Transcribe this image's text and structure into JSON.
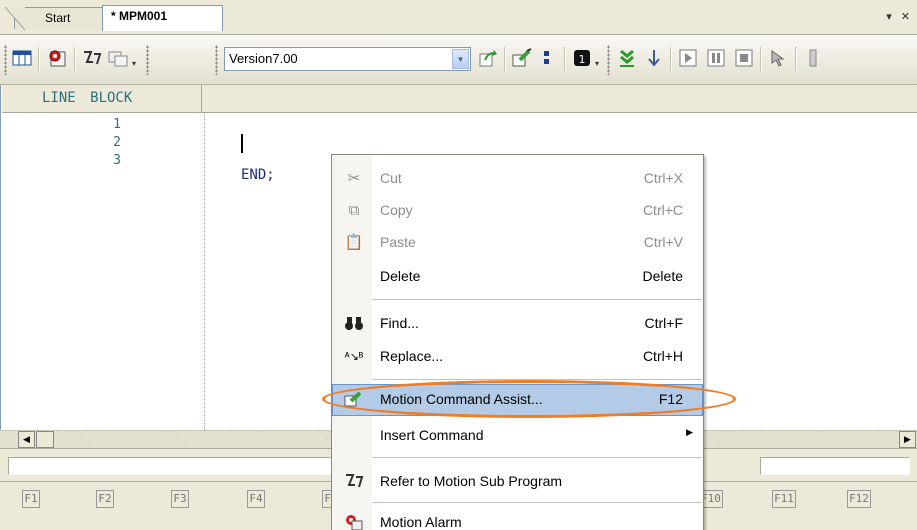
{
  "tabs": {
    "start_label": "Start",
    "active_label": "* MPM001",
    "controls": "▾ ✕"
  },
  "toolbar": {
    "version_value": "Version7.00",
    "icons": [
      "list-window-icon",
      "motion-search-icon",
      "motion-sub-icon",
      "transfer-icon",
      "motion-command-assist-icon",
      "semicolon-icon",
      "step-icon",
      "step-into-icon",
      "step-down-icon",
      "run-icon",
      "pause-icon",
      "stop-icon",
      "pointer-icon"
    ]
  },
  "editor": {
    "header": "LINE BLOCK",
    "line_numbers": [
      "1",
      "2",
      "3"
    ],
    "code_lines": [
      "",
      "",
      "END;"
    ]
  },
  "function_keys": [
    "F1",
    "F2",
    "F3",
    "F4",
    "F5",
    "F10",
    "F11",
    "F12"
  ],
  "context_menu": {
    "items": [
      {
        "label": "Cut",
        "shortcut": "Ctrl+X",
        "icon": "scissors-icon",
        "disabled": true
      },
      {
        "label": "Copy",
        "shortcut": "Ctrl+C",
        "icon": "copy-icon",
        "disabled": true
      },
      {
        "label": "Paste",
        "shortcut": "Ctrl+V",
        "icon": "paste-icon",
        "disabled": true
      },
      {
        "label": "Delete",
        "shortcut": "Delete",
        "icon": "",
        "disabled": false
      },
      {
        "label": "Find...",
        "shortcut": "Ctrl+F",
        "icon": "binoculars-icon",
        "disabled": false
      },
      {
        "label": "Replace...",
        "shortcut": "Ctrl+H",
        "icon": "replace-icon",
        "disabled": false
      },
      {
        "label": "Motion Command Assist...",
        "shortcut": "F12",
        "icon": "motion-command-assist-icon",
        "disabled": false
      },
      {
        "label": "Insert Command",
        "shortcut": "",
        "icon": "",
        "disabled": false
      },
      {
        "label": "Refer to Motion Sub Program",
        "shortcut": "",
        "icon": "motion-sub-icon",
        "disabled": false
      },
      {
        "label": "Motion Alarm",
        "shortcut": "",
        "icon": "alarm-icon",
        "disabled": false
      }
    ]
  },
  "colors": {
    "highlight_oval": "#f07d24",
    "menu_highlight": "#b3cbe6",
    "line_number_color": "#2b6f80",
    "code_color": "#1a2c7a"
  }
}
